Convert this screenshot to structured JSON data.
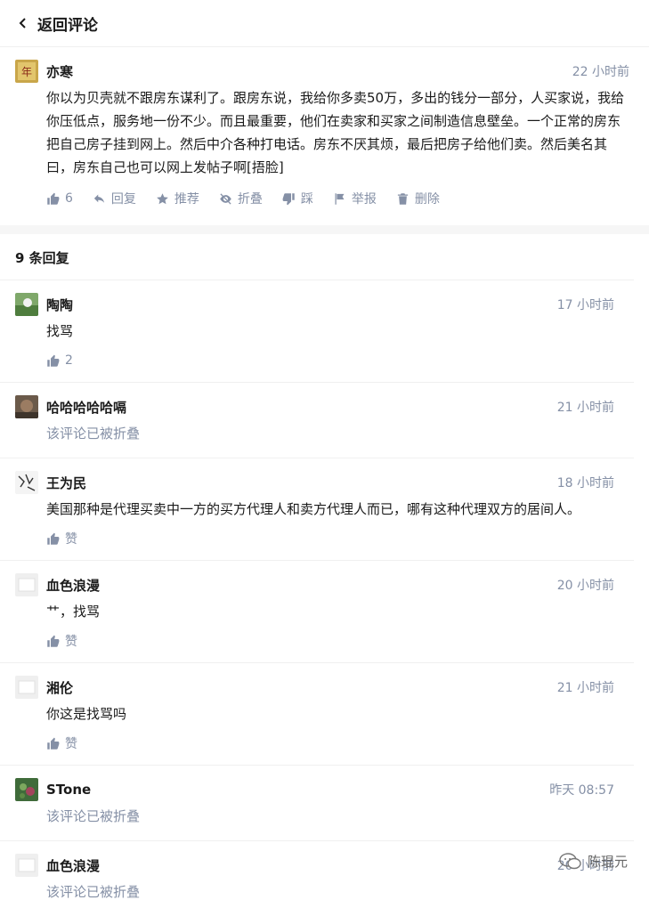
{
  "header": {
    "title": "返回评论"
  },
  "root": {
    "author": "亦寒",
    "time": "22 小时前",
    "content": "你以为贝壳就不跟房东谋利了。跟房东说，我给你多卖50万，多出的钱分一部分，人买家说，我给你压低点，服务地一份不少。而且最重要，他们在卖家和买家之间制造信息壁垒。一个正常的房东把自己房子挂到网上。然后中介各种打电话。房东不厌其烦，最后把房子给他们卖。然后美名其曰，房东自己也可以网上发帖子啊[捂脸]",
    "actions": {
      "like": "6",
      "reply": "回复",
      "recommend": "推荐",
      "fold": "折叠",
      "dislike": "踩",
      "report": "举报",
      "delete": "删除"
    }
  },
  "reply_count": "9 条回复",
  "replies": [
    {
      "author": "陶陶",
      "time": "17 小时前",
      "content": "找骂",
      "like": "2"
    },
    {
      "author": "哈哈哈哈哈嗝",
      "time": "21 小时前",
      "collapsed": "该评论已被折叠"
    },
    {
      "author": "王为民",
      "time": "18 小时前",
      "content": "美国那种是代理买卖中一方的买方代理人和卖方代理人而已，哪有这种代理双方的居间人。",
      "like": "赞"
    },
    {
      "author": "血色浪漫",
      "time": "20 小时前",
      "content": "艹，找骂",
      "like": "赞"
    },
    {
      "author": "湘伦",
      "time": "21 小时前",
      "content": "你这是找骂吗",
      "like": "赞"
    },
    {
      "author": "STone",
      "time": "昨天 08:57",
      "collapsed": "该评论已被折叠"
    },
    {
      "author": "血色浪漫",
      "time": "20 小时前",
      "collapsed": "该评论已被折叠"
    }
  ],
  "watermark": {
    "text": "陈琨元",
    "icon": "wechat-icon"
  },
  "colors": {
    "meta": "#8590a6",
    "divider": "#f0f0f0",
    "band": "#f6f6f6"
  }
}
